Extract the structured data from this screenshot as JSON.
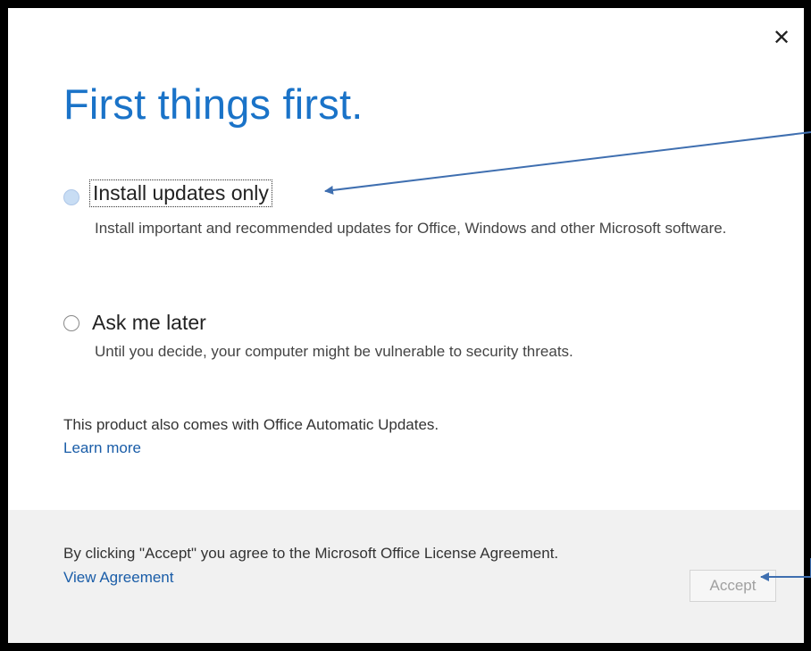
{
  "dialog": {
    "close_glyph": "✕",
    "title": "First things first.",
    "options": [
      {
        "label": "Install updates only",
        "description": "Install important and recommended updates for Office, Windows and other Microsoft software.",
        "selected": false,
        "focused": true
      },
      {
        "label": "Ask me later",
        "description": "Until you decide, your computer might be vulnerable to security threats.",
        "selected": false,
        "focused": false
      }
    ],
    "info_text": "This product also comes with Office Automatic Updates.",
    "learn_more": "Learn more",
    "footer": {
      "agreement_text": "By clicking \"Accept\" you agree to the Microsoft Office License Agreement.",
      "view_agreement": "View Agreement",
      "accept_label": "Accept",
      "accept_enabled": false
    }
  },
  "colors": {
    "title": "#1a73c8",
    "link": "#1a5da8",
    "annotation_arrow": "#3f6fb0",
    "footer_bg": "#f1f1f1"
  }
}
